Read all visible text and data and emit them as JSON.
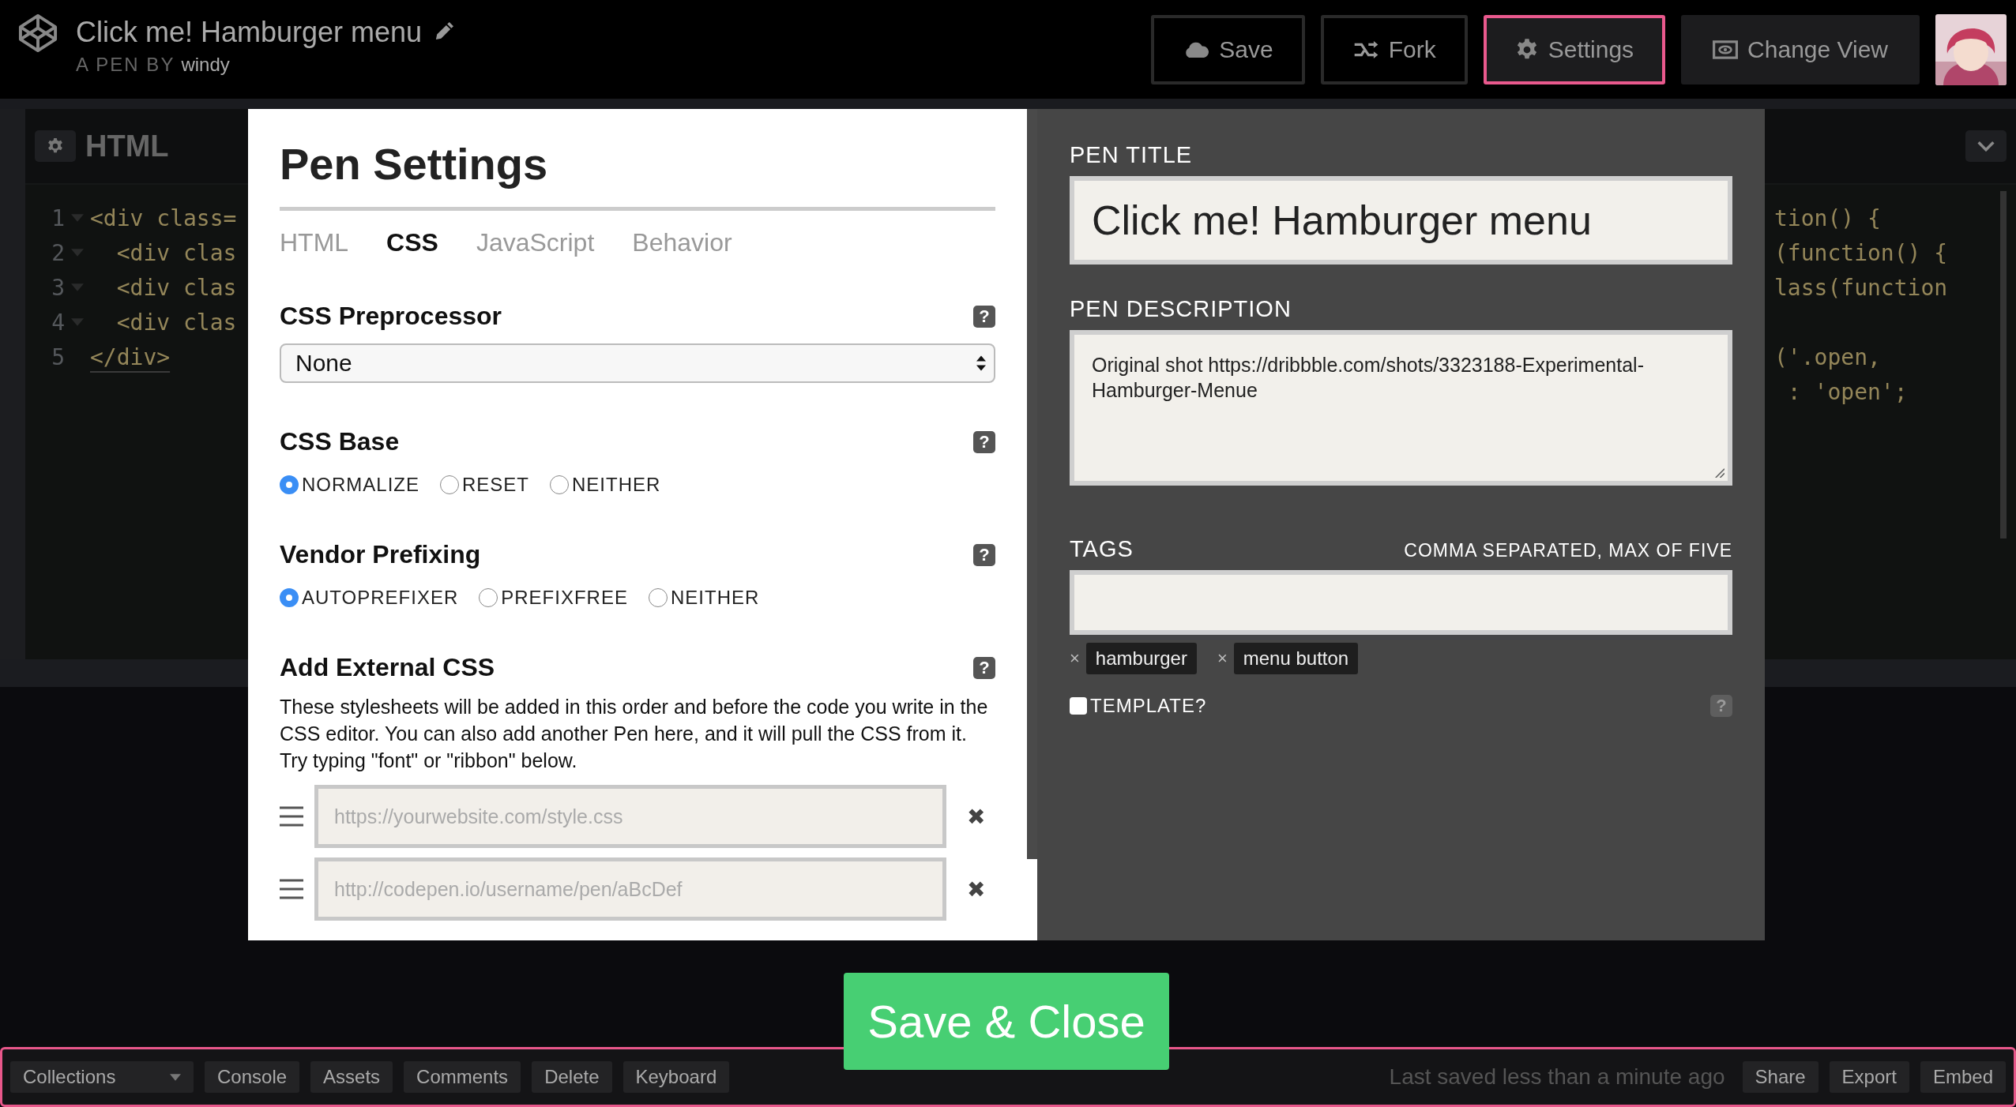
{
  "header": {
    "pen_title": "Click me! Hamburger menu",
    "byline_prefix": "A PEN BY",
    "author": "windy",
    "buttons": [
      {
        "kind": "save",
        "label": "Save",
        "selected": false
      },
      {
        "kind": "fork",
        "label": "Fork",
        "selected": false
      },
      {
        "kind": "settings",
        "label": "Settings",
        "selected": true
      },
      {
        "kind": "view",
        "label": "Change View",
        "selected": false
      }
    ]
  },
  "editor": {
    "title": "HTML",
    "lines": [
      {
        "number": "1",
        "foldable": true,
        "code": "<div class="
      },
      {
        "number": "2",
        "foldable": true,
        "code": "  <div clas"
      },
      {
        "number": "3",
        "foldable": true,
        "code": "  <div clas"
      },
      {
        "number": "4",
        "foldable": true,
        "code": "  <div clas"
      },
      {
        "number": "5",
        "foldable": false,
        "code": "</div>"
      }
    ],
    "right_lines": [
      {
        "code": "tion() {",
        "blank_before": false
      },
      {
        "code": "(function() {",
        "blank_before": false
      },
      {
        "code": "lass(function",
        "blank_before": false
      },
      {
        "code": "('.open,",
        "blank_before": true
      },
      {
        "code": " : 'open';",
        "blank_before": false
      }
    ]
  },
  "settings_modal": {
    "title": "Pen Settings",
    "tabs": [
      {
        "label": "HTML",
        "selected": false
      },
      {
        "label": "CSS",
        "selected": true
      },
      {
        "label": "JavaScript",
        "selected": false
      },
      {
        "label": "Behavior",
        "selected": false
      }
    ],
    "sections": [
      {
        "kind": "select",
        "heading": "CSS Preprocessor",
        "help": "?",
        "value": "None"
      },
      {
        "kind": "radio",
        "heading": "CSS Base",
        "help": "?",
        "options": [
          {
            "label": "NORMALIZE",
            "selected": true
          },
          {
            "label": "RESET",
            "selected": false
          },
          {
            "label": "NEITHER",
            "selected": false
          }
        ]
      },
      {
        "kind": "radio",
        "heading": "Vendor Prefixing",
        "help": "?",
        "options": [
          {
            "label": "AUTOPREFIXER",
            "selected": true
          },
          {
            "label": "PREFIXFREE",
            "selected": false
          },
          {
            "label": "NEITHER",
            "selected": false
          }
        ]
      },
      {
        "kind": "external",
        "heading": "Add External CSS",
        "help": "?",
        "description": "These stylesheets will be added in this order and before the code you write in the CSS editor. You can also add another Pen here, and it will pull the CSS from it. Try typing \"font\" or \"ribbon\" below.",
        "inputs": [
          {
            "placeholder": "https://yourwebsite.com/style.css",
            "remove": "✖"
          },
          {
            "placeholder": "http://codepen.io/username/pen/aBcDef",
            "remove": "✖"
          }
        ]
      }
    ],
    "details": {
      "title_label": "PEN TITLE",
      "title_value": "Click me! Hamburger menu",
      "description_label": "PEN DESCRIPTION",
      "description_value": "Original shot https://dribbble.com/shots/3323188-Experimental-Hamburger-Menue",
      "tags_label": "TAGS",
      "tags_hint": "COMMA SEPARATED, MAX OF FIVE",
      "tags": [
        {
          "remove": "×",
          "label": "hamburger"
        },
        {
          "remove": "×",
          "label": "menu button"
        }
      ],
      "template": {
        "label": "TEMPLATE?",
        "checked": false,
        "help": "?"
      }
    },
    "save_close": "Save & Close"
  },
  "footer": {
    "collections": "Collections",
    "buttons": [
      "Console",
      "Assets",
      "Comments",
      "Delete",
      "Keyboard"
    ],
    "status": "Last saved less than a minute ago",
    "right_buttons": [
      "Share",
      "Export",
      "Embed"
    ]
  }
}
